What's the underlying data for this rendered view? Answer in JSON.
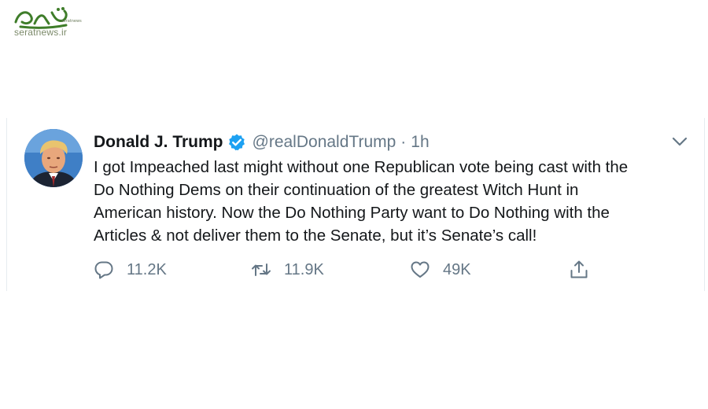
{
  "watermark": {
    "domain": "seratnews.ir",
    "logo_name": "Serat News"
  },
  "tweet": {
    "author": {
      "display_name": "Donald J. Trump",
      "handle": "@realDonaldTrump",
      "verified": true
    },
    "separator": "·",
    "time": "1h",
    "text_lines": [
      "I got Impeached last might without one Republican vote being cast with the",
      "Do Nothing Dems on their continuation of the greatest Witch Hunt in",
      "American history. Now the Do Nothing Party want to Do Nothing with the",
      "Articles & not deliver them to the Senate, but it’s Senate’s call!"
    ],
    "actions": {
      "reply": {
        "icon": "reply-icon",
        "count": "11.2K"
      },
      "retweet": {
        "icon": "retweet-icon",
        "count": "11.9K"
      },
      "like": {
        "icon": "heart-icon",
        "count": "49K"
      },
      "share": {
        "icon": "share-icon"
      }
    }
  },
  "colors": {
    "text": "#14171a",
    "secondary": "#657786",
    "verified": "#1da1f2",
    "border": "#e6ecf0",
    "watermark_green": "#3f7d2a"
  }
}
